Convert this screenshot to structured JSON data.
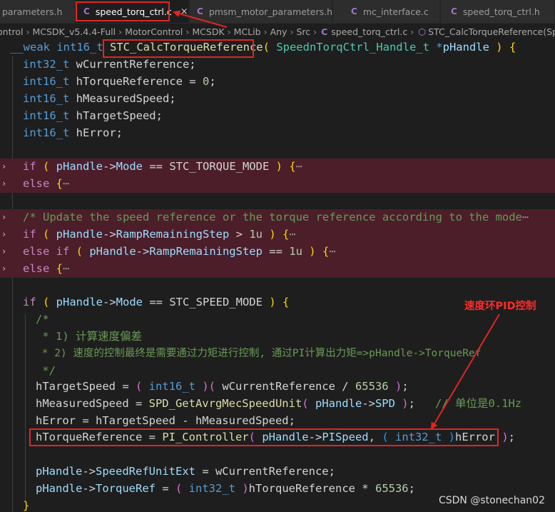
{
  "tabs": [
    {
      "label": "parameters.h",
      "active": false,
      "show_icon": false
    },
    {
      "label": "speed_torq_ctrl.c",
      "active": true,
      "show_icon": true
    },
    {
      "label": "pmsm_motor_parameters.h",
      "active": false,
      "show_icon": true
    },
    {
      "label": "mc_interface.c",
      "active": false,
      "show_icon": true
    },
    {
      "label": "speed_torq_ctrl.h",
      "active": false,
      "show_icon": true
    }
  ],
  "tab_icon_glyph": "C",
  "tab_close_glyph": "×",
  "breadcrumb": {
    "items": [
      "ontrol",
      "MCSDK_v5.4.4-Full",
      "MotorControl",
      "MCSDK",
      "MCLib",
      "Any",
      "Src"
    ],
    "file": "speed_torq_ctrl.c",
    "symbol": "STC_CalcTorqueReference(Speed"
  },
  "code": {
    "l01": {
      "weak": "__weak ",
      "type": "int16_t",
      "fn": "STC_CalcTorqueReference",
      "open": "( ",
      "ptype": "SpeednTorqCtrl_Handle_t ",
      "ptr": "*",
      "param": "pHandle",
      "close": " ) ",
      "brace": "{"
    },
    "l02": {
      "type": "int32_t",
      "rest": " wCurrentReference;"
    },
    "l03": {
      "type": "int16_t",
      "name": " hTorqueReference = ",
      "num": "0",
      "end": ";"
    },
    "l04": {
      "type": "int16_t",
      "rest": " hMeasuredSpeed;"
    },
    "l05": {
      "type": "int16_t",
      "rest": " hTargetSpeed;"
    },
    "l06": {
      "type": "int16_t",
      "rest": " hError;"
    },
    "l08": {
      "kw": "if",
      "open": " ( ",
      "var": "pHandle",
      "arrow": "->",
      "field": "Mode",
      "op": " == ",
      "const": "STC_TORQUE_MODE",
      "close": " ) ",
      "brace": "{",
      "ellip": "⋯"
    },
    "l09": {
      "kw": "else",
      "brace": " {",
      "ellip": "⋯"
    },
    "l11": {
      "comment": "/* Update the speed reference or the torque reference according to the mode",
      "ellip": "⋯"
    },
    "l12": {
      "kw": "if",
      "open": " ( ",
      "var": "pHandle",
      "arrow": "->",
      "field": "RampRemainingStep",
      "op": " > ",
      "num": "1u",
      "close": " ) ",
      "brace": "{",
      "ellip": "⋯"
    },
    "l13": {
      "kw": "else if",
      "open": " ( ",
      "var": "pHandle",
      "arrow": "->",
      "field": "RampRemainingStep",
      "op": " == ",
      "num": "1u",
      "close": " ) ",
      "brace": "{",
      "ellip": "⋯"
    },
    "l14": {
      "kw": "else",
      "brace": " {",
      "ellip": "⋯"
    },
    "l16": {
      "kw": "if",
      "open": " ( ",
      "var": "pHandle",
      "arrow": "->",
      "field": "Mode",
      "op": " == ",
      "const": "STC_SPEED_MODE",
      "close": " ) ",
      "brace": "{"
    },
    "l17": {
      "comment": "/*"
    },
    "l18": {
      "comment": " * 1) 计算速度偏差"
    },
    "l19": {
      "comment": " * 2) 速度的控制最终是需要通过力矩进行控制, 通过PI计算出力矩=>pHandle->TorqueRef"
    },
    "l20": {
      "comment": " */"
    },
    "l21": {
      "lhs": "hTargetSpeed = ",
      "open": "( ",
      "type": "int16_t",
      "close": " )",
      "open2": "(",
      "var": " wCurrentReference / ",
      "num": "65536",
      "close2": " )",
      "end": ";"
    },
    "l22": {
      "lhs": "hMeasuredSpeed = ",
      "fn": "SPD_GetAvrgMecSpeedUnit",
      "open": "( ",
      "var": "pHandle",
      "arrow": "->",
      "field": "SPD",
      "close": " )",
      "end": ";",
      "comment": "   // 单位是0.1Hz"
    },
    "l23": {
      "text": "hError = hTargetSpeed - hMeasuredSpeed;"
    },
    "l24": {
      "lhs": "hTorqueReference = ",
      "fn": "PI_Controller",
      "open": "( ",
      "var": "pHandle",
      "arrow": "->",
      "field": "PISpeed",
      "comma": ", ",
      "open2": "( ",
      "type": "int32_t",
      "close2": " )",
      "var2": "hError",
      "close": " )",
      "end": ";"
    },
    "l26": {
      "var": "pHandle",
      "arrow": "->",
      "field": "SpeedRefUnitExt",
      "rest": " = wCurrentReference;"
    },
    "l27": {
      "var": "pHandle",
      "arrow": "->",
      "field": "TorqueRef",
      "eq": " = ",
      "open": "( ",
      "type": "int32_t",
      "close": " )",
      "rest": "hTorqueReference * ",
      "num": "65536",
      "end": ";"
    },
    "l28": {
      "brace": "}"
    }
  },
  "annotation_label": "速度环PID控制",
  "watermark": "CSDN @stonechan02",
  "colors": {
    "annotation_red": "#e02525",
    "fold_bg": "#4b1e2a",
    "keyword": "#569cd6",
    "function": "#dcdcaa",
    "comment": "#6a9955",
    "variable": "#9cdcfe",
    "number": "#b5cea8"
  }
}
